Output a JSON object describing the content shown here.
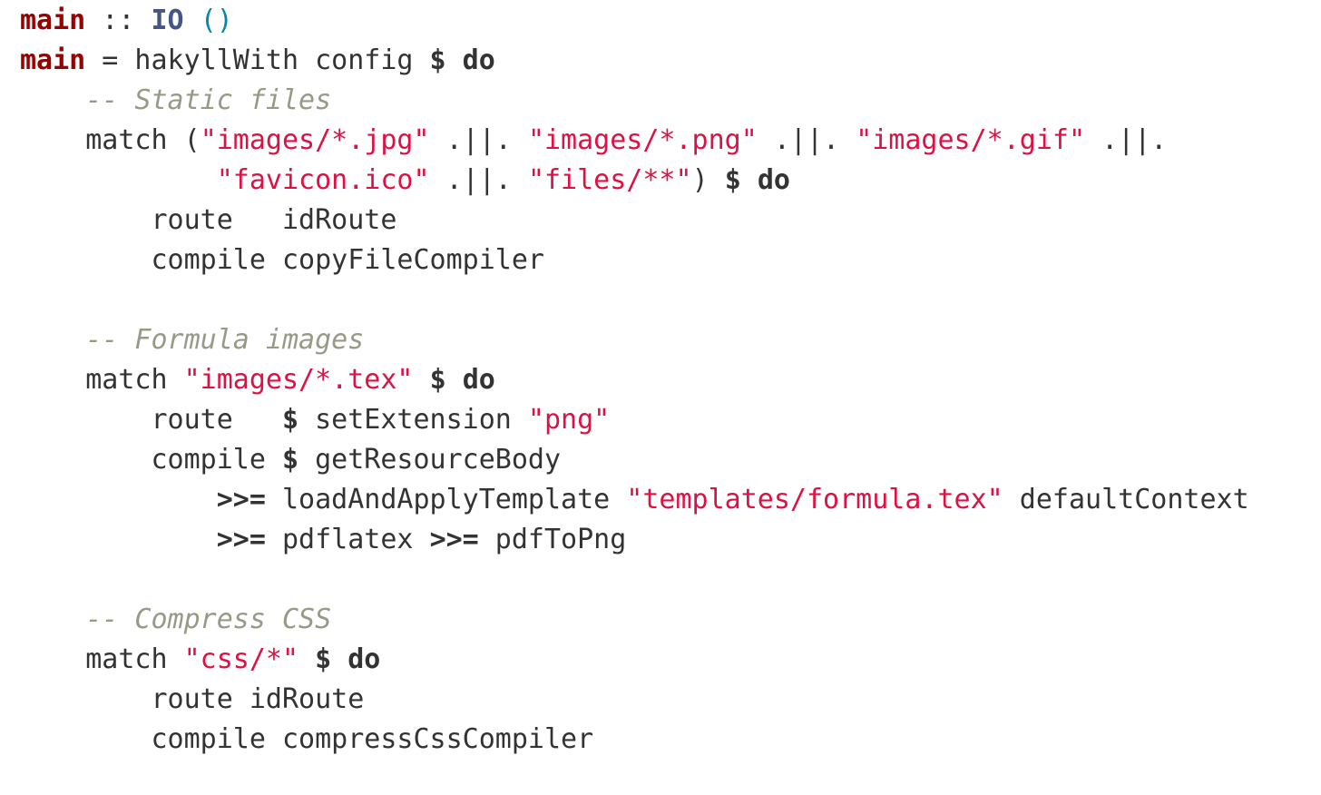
{
  "editor": {
    "background": "#ffffff",
    "colors": {
      "name": "#990000",
      "type": "#445588",
      "paren": "#0086b3",
      "keyword": "#333333",
      "identifier": "#333333",
      "string": "#dd1144",
      "comment": "#999988"
    },
    "lines": [
      {
        "tokens": [
          {
            "t": "main",
            "c": "name"
          },
          {
            "t": " :: ",
            "c": "op"
          },
          {
            "t": "IO",
            "c": "type"
          },
          {
            "t": " ",
            "c": "id"
          },
          {
            "t": "()",
            "c": "paren"
          }
        ]
      },
      {
        "tokens": [
          {
            "t": "main",
            "c": "name"
          },
          {
            "t": " = hakyllWith config ",
            "c": "id"
          },
          {
            "t": "$",
            "c": "kw"
          },
          {
            "t": " ",
            "c": "id"
          },
          {
            "t": "do",
            "c": "kw"
          }
        ]
      },
      {
        "tokens": [
          {
            "t": "    ",
            "c": "id"
          },
          {
            "t": "-- Static files",
            "c": "comment"
          }
        ]
      },
      {
        "tokens": [
          {
            "t": "    match (",
            "c": "id"
          },
          {
            "t": "\"images/*.jpg\"",
            "c": "str"
          },
          {
            "t": " .||. ",
            "c": "id"
          },
          {
            "t": "\"images/*.png\"",
            "c": "str"
          },
          {
            "t": " .||. ",
            "c": "id"
          },
          {
            "t": "\"images/*.gif\"",
            "c": "str"
          },
          {
            "t": " .||.",
            "c": "id"
          }
        ]
      },
      {
        "tokens": [
          {
            "t": "            ",
            "c": "id"
          },
          {
            "t": "\"favicon.ico\"",
            "c": "str"
          },
          {
            "t": " .||. ",
            "c": "id"
          },
          {
            "t": "\"files/**\"",
            "c": "str"
          },
          {
            "t": ") ",
            "c": "id"
          },
          {
            "t": "$",
            "c": "kw"
          },
          {
            "t": " ",
            "c": "id"
          },
          {
            "t": "do",
            "c": "kw"
          }
        ]
      },
      {
        "tokens": [
          {
            "t": "        route   idRoute",
            "c": "id"
          }
        ]
      },
      {
        "tokens": [
          {
            "t": "        compile copyFileCompiler",
            "c": "id"
          }
        ]
      },
      {
        "tokens": [
          {
            "t": "",
            "c": "id"
          }
        ]
      },
      {
        "tokens": [
          {
            "t": "    ",
            "c": "id"
          },
          {
            "t": "-- Formula images",
            "c": "comment"
          }
        ]
      },
      {
        "tokens": [
          {
            "t": "    match ",
            "c": "id"
          },
          {
            "t": "\"images/*.tex\"",
            "c": "str"
          },
          {
            "t": " ",
            "c": "id"
          },
          {
            "t": "$",
            "c": "kw"
          },
          {
            "t": " ",
            "c": "id"
          },
          {
            "t": "do",
            "c": "kw"
          }
        ]
      },
      {
        "tokens": [
          {
            "t": "        route   ",
            "c": "id"
          },
          {
            "t": "$",
            "c": "kw"
          },
          {
            "t": " setExtension ",
            "c": "id"
          },
          {
            "t": "\"png\"",
            "c": "str"
          }
        ]
      },
      {
        "tokens": [
          {
            "t": "        compile ",
            "c": "id"
          },
          {
            "t": "$",
            "c": "kw"
          },
          {
            "t": " getResourceBody",
            "c": "id"
          }
        ]
      },
      {
        "tokens": [
          {
            "t": "            ",
            "c": "id"
          },
          {
            "t": ">>=",
            "c": "kw"
          },
          {
            "t": " loadAndApplyTemplate ",
            "c": "id"
          },
          {
            "t": "\"templates/formula.tex\"",
            "c": "str"
          },
          {
            "t": " defaultContext",
            "c": "id"
          }
        ]
      },
      {
        "tokens": [
          {
            "t": "            ",
            "c": "id"
          },
          {
            "t": ">>=",
            "c": "kw"
          },
          {
            "t": " pdflatex ",
            "c": "id"
          },
          {
            "t": ">>=",
            "c": "kw"
          },
          {
            "t": " pdfToPng",
            "c": "id"
          }
        ]
      },
      {
        "tokens": [
          {
            "t": "",
            "c": "id"
          }
        ]
      },
      {
        "tokens": [
          {
            "t": "    ",
            "c": "id"
          },
          {
            "t": "-- Compress CSS",
            "c": "comment"
          }
        ]
      },
      {
        "tokens": [
          {
            "t": "    match ",
            "c": "id"
          },
          {
            "t": "\"css/*\"",
            "c": "str"
          },
          {
            "t": " ",
            "c": "id"
          },
          {
            "t": "$",
            "c": "kw"
          },
          {
            "t": " ",
            "c": "id"
          },
          {
            "t": "do",
            "c": "kw"
          }
        ]
      },
      {
        "tokens": [
          {
            "t": "        route idRoute",
            "c": "id"
          }
        ]
      },
      {
        "tokens": [
          {
            "t": "        compile compressCssCompiler",
            "c": "id"
          }
        ]
      }
    ]
  }
}
